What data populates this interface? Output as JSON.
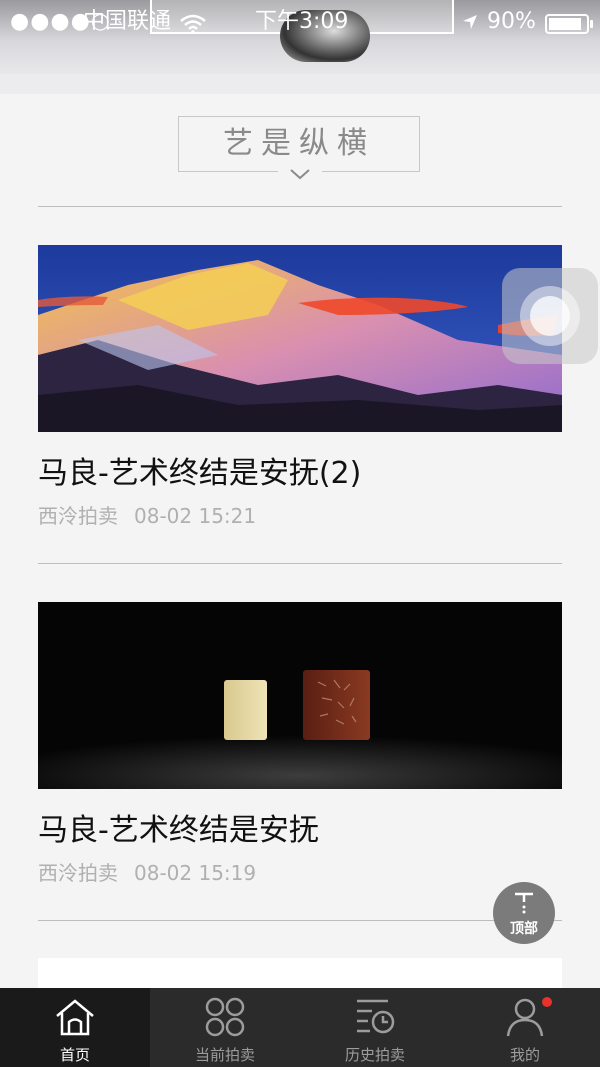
{
  "status_bar": {
    "signal": "●●●●○",
    "carrier": "中国联通",
    "time": "下午3:09",
    "battery": "90%",
    "battery_level": 0.9
  },
  "section": {
    "title": "艺是纵横"
  },
  "articles": [
    {
      "title": "马良-艺术终结是安抚(2)",
      "source": "西泠拍卖",
      "time": "08-02 15:21"
    },
    {
      "title": "马良-艺术终结是安抚",
      "source": "西泠拍卖",
      "time": "08-02 15:19"
    }
  ],
  "back_to_top": {
    "label": "顶部"
  },
  "tabs": [
    {
      "label": "首页",
      "icon": "home-icon",
      "active": true
    },
    {
      "label": "当前拍卖",
      "icon": "grid-icon",
      "active": false
    },
    {
      "label": "历史拍卖",
      "icon": "history-icon",
      "active": false
    },
    {
      "label": "我的",
      "icon": "user-icon",
      "active": false,
      "badge": true
    }
  ],
  "colors": {
    "tab_bar": "#2b2b2b",
    "tab_active": "#1a1a1a",
    "badge": "#e8322b",
    "meta_text": "#b0b0b0"
  }
}
